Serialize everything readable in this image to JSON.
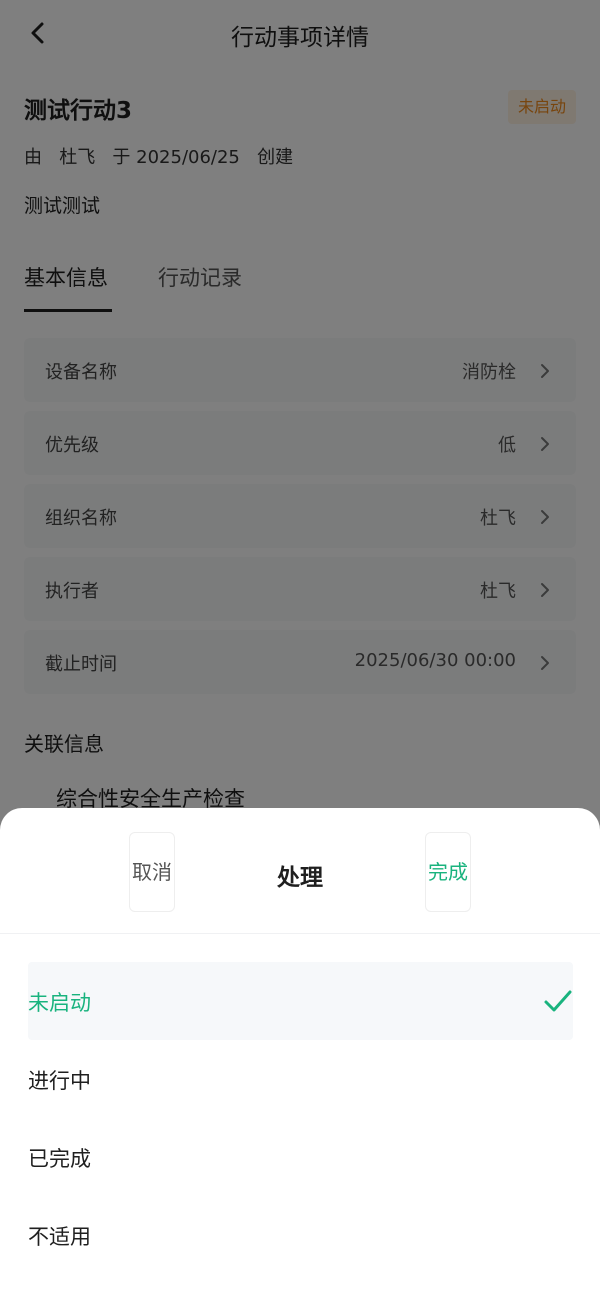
{
  "nav": {
    "back_icon": "chevron-left-icon",
    "title": "行动事项详情"
  },
  "item": {
    "title": "测试行动3",
    "status_badge": "未启动",
    "creator_prefix": "由",
    "creator_name": "杜飞",
    "creator_mid": "于",
    "created_date": "2025/06/25",
    "creator_suffix": "创建",
    "description": "测试测试"
  },
  "tabs": [
    {
      "label": "基本信息",
      "active": true
    },
    {
      "label": "行动记录",
      "active": false
    }
  ],
  "info_rows": [
    {
      "label": "设备名称",
      "value": "消防栓"
    },
    {
      "label": "优先级",
      "value": "低"
    },
    {
      "label": "组织名称",
      "value": "杜飞"
    },
    {
      "label": "执行者",
      "value": "杜飞"
    },
    {
      "label": "截止时间",
      "value": "2025/06/30 00:00"
    }
  ],
  "related": {
    "heading": "关联信息",
    "item": "综合性安全生产检查"
  },
  "sheet": {
    "cancel_label": "取消",
    "title": "处理",
    "done_label": "完成",
    "options": [
      {
        "label": "未启动",
        "selected": true
      },
      {
        "label": "进行中",
        "selected": false
      },
      {
        "label": "已完成",
        "selected": false
      },
      {
        "label": "不适用",
        "selected": false
      }
    ]
  },
  "colors": {
    "accent_green": "#19b37e",
    "badge_orange": "#f08a1c",
    "badge_bg": "#fff2e3",
    "row_bg": "#f6f8f9",
    "overlay": "rgba(0,0,0,0.5)"
  }
}
